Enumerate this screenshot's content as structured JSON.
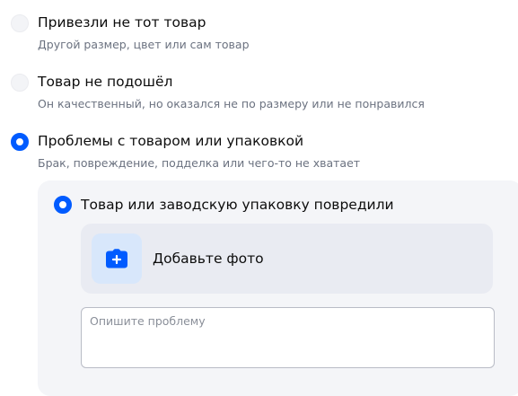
{
  "options": [
    {
      "title": "Привезли не тот товар",
      "subtitle": "Другой размер, цвет или сам товар",
      "selected": false
    },
    {
      "title": "Товар не подошёл",
      "subtitle": "Он качественный, но оказался не по размеру или не понравился",
      "selected": false
    },
    {
      "title": "Проблемы с товаром или упаковкой",
      "subtitle": "Брак, повреждение, подделка или чего-то не хватает",
      "selected": true
    }
  ],
  "details": {
    "sub_option": {
      "title": "Товар или заводскую упаковку повредили",
      "selected": true
    },
    "add_photo_label": "Добавьте фото",
    "add_photo_icon": "camera-plus-icon",
    "problem_placeholder": "Опишите проблему",
    "problem_value": ""
  },
  "colors": {
    "accent": "#005bff",
    "icon_background": "#d8e7fb"
  }
}
